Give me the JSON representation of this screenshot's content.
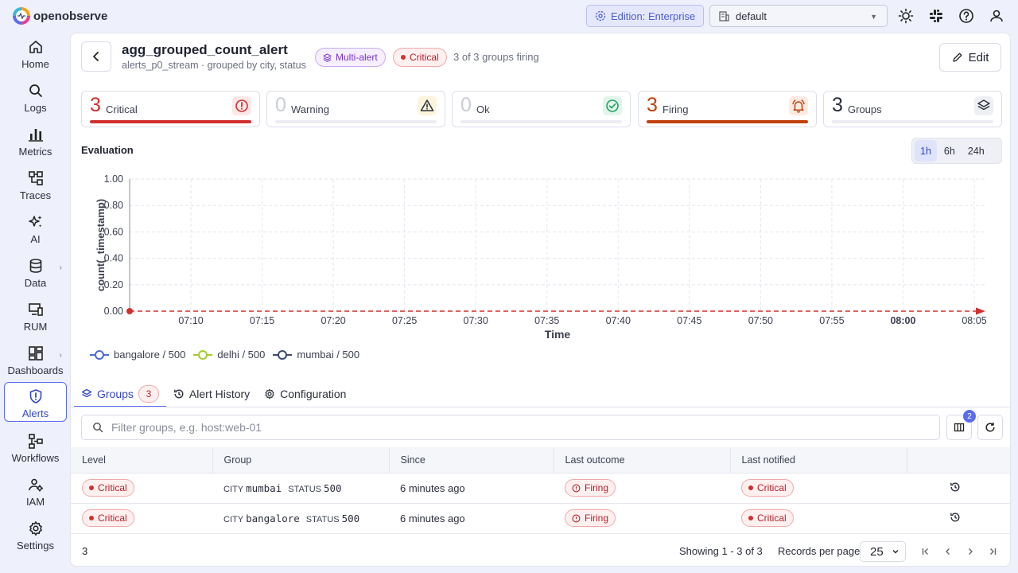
{
  "app": {
    "name": "openobserve"
  },
  "header": {
    "edition_label": "Edition: Enterprise",
    "org_label": "default"
  },
  "sidebar": {
    "items": [
      {
        "label": "Home",
        "icon": "home-icon"
      },
      {
        "label": "Logs",
        "icon": "search-icon"
      },
      {
        "label": "Metrics",
        "icon": "bar-chart-icon"
      },
      {
        "label": "Traces",
        "icon": "traces-icon"
      },
      {
        "label": "AI",
        "icon": "sparkle-icon"
      },
      {
        "label": "Data",
        "icon": "database-icon"
      },
      {
        "label": "RUM",
        "icon": "devices-icon"
      },
      {
        "label": "Dashboards",
        "icon": "dashboard-icon"
      },
      {
        "label": "Alerts",
        "icon": "alert-shield-icon"
      },
      {
        "label": "Workflows",
        "icon": "workflow-icon"
      },
      {
        "label": "IAM",
        "icon": "users-icon"
      },
      {
        "label": "Settings",
        "icon": "gear-icon"
      }
    ],
    "active": "Alerts"
  },
  "alert": {
    "name": "agg_grouped_count_alert",
    "subtitle": "alerts_p0_stream · grouped by city, status",
    "type_badge": "Multi-alert",
    "severity_badge": "Critical",
    "firing_summary": "3 of 3 groups firing",
    "edit_label": "Edit"
  },
  "stats": [
    {
      "count": "3",
      "label": "Critical",
      "color": "#d32f2f",
      "fill": 1.0
    },
    {
      "count": "0",
      "label": "Warning",
      "color": "#f0b400",
      "fill": 0
    },
    {
      "count": "0",
      "label": "Ok",
      "color": "#21a366",
      "fill": 0
    },
    {
      "count": "3",
      "label": "Firing",
      "color": "#c2410c",
      "fill": 1.0
    },
    {
      "count": "3",
      "label": "Groups",
      "color": "#5a5f70",
      "fill": 0
    }
  ],
  "evaluation": {
    "title": "Evaluation",
    "ranges": [
      "1h",
      "6h",
      "24h"
    ],
    "active_range": "1h"
  },
  "chart_data": {
    "type": "line",
    "xlabel": "Time",
    "ylabel": "count(_timestamp)",
    "ylim": [
      0,
      1
    ],
    "yticks": [
      "1.00",
      "0.80",
      "0.60",
      "0.40",
      "0.20",
      "0.00"
    ],
    "xticks": [
      "07:10",
      "07:15",
      "07:20",
      "07:25",
      "07:30",
      "07:35",
      "07:40",
      "07:45",
      "07:50",
      "07:55",
      "08:00",
      "08:05"
    ],
    "grid": true,
    "legend_position": "bottom-left",
    "series": [
      {
        "name": "bangalore / 500",
        "color": "#4a6ad6",
        "values": []
      },
      {
        "name": "delhi / 500",
        "color": "#a3cf2c",
        "values": []
      },
      {
        "name": "mumbai / 500",
        "color": "#3c4a6e",
        "values": []
      }
    ],
    "threshold": {
      "value": 0,
      "color": "#d32f2f"
    }
  },
  "tabs": [
    {
      "label": "Groups",
      "badge": "3",
      "icon": "layers-icon"
    },
    {
      "label": "Alert History",
      "icon": "history-icon"
    },
    {
      "label": "Configuration",
      "icon": "gear-icon"
    }
  ],
  "groups": {
    "search_placeholder": "Filter groups, e.g. host:web-01",
    "columns_badge": "2",
    "headers": [
      "Level",
      "Group",
      "Since",
      "Last outcome",
      "Last notified",
      ""
    ],
    "rows": [
      {
        "level": "Critical",
        "key1": "CITY",
        "val1": "mumbai",
        "key2": "STATUS",
        "val2": "500",
        "since": "6 minutes ago",
        "outcome": "Firing",
        "notified": "Critical"
      },
      {
        "level": "Critical",
        "key1": "CITY",
        "val1": "bangalore",
        "key2": "STATUS",
        "val2": "500",
        "since": "6 minutes ago",
        "outcome": "Firing",
        "notified": "Critical"
      }
    ],
    "total": "3",
    "showing": "Showing 1 - 3 of 3",
    "records_per_page_label": "Records per page",
    "records_per_page": "25"
  }
}
